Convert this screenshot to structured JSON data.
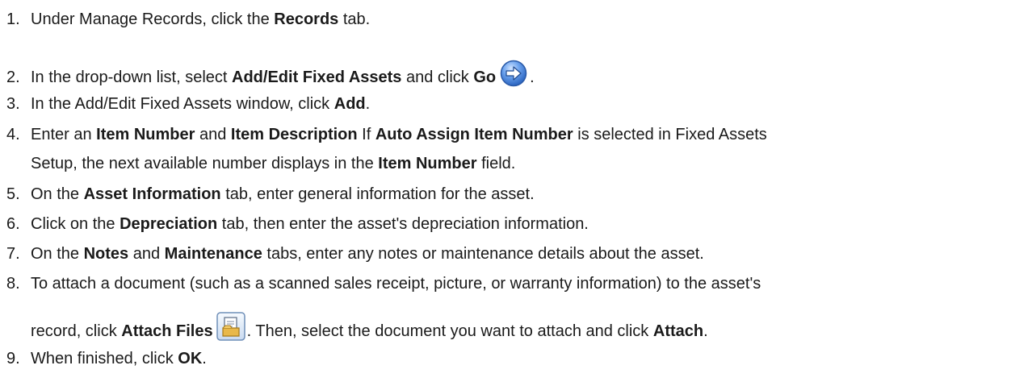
{
  "steps": [
    {
      "num": "1.",
      "pre": "Under Manage Records, click the ",
      "b1": "Records",
      "post": " tab."
    },
    {
      "num": "2.",
      "pre": "In the drop-down list, select ",
      "b1": "Add/Edit Fixed Assets",
      "mid": " and click ",
      "b2": "Go",
      "icon": "go-arrow-icon",
      "post": "."
    },
    {
      "num": "3.",
      "pre": "In the Add/Edit Fixed Assets window, click ",
      "b1": "Add",
      "post": "."
    },
    {
      "num": "4.",
      "line1": {
        "pre": "Enter an ",
        "b1": "Item Number",
        "mid1": " and ",
        "b2": "Item Description",
        "mid2": " If ",
        "b3": "Auto Assign Item Number",
        "post": " is selected in Fixed Assets"
      },
      "line2": {
        "pre": "Setup, the next available number displays in the ",
        "b1": "Item Number",
        "post": " field."
      }
    },
    {
      "num": "5.",
      "pre": "On the ",
      "b1": "Asset Information",
      "post": " tab, enter general information for the asset."
    },
    {
      "num": "6.",
      "pre": "Click on the ",
      "b1": "Depreciation",
      "post": " tab, then enter the asset's depreciation information."
    },
    {
      "num": "7.",
      "pre": "On the ",
      "b1": "Notes",
      "mid": " and ",
      "b2": "Maintenance",
      "post": " tabs, enter any notes or maintenance details about the asset."
    },
    {
      "num": "8.",
      "line1": {
        "text": "To attach a document (such as a scanned sales receipt, picture, or warranty information) to the asset's"
      },
      "line2": {
        "pre": "record, click ",
        "b1": "Attach Files",
        "icon": "attach-files-icon",
        "mid": ". Then, select the document you want to attach and click ",
        "b2": "Attach",
        "post": "."
      }
    },
    {
      "num": "9.",
      "pre": "When finished, click ",
      "b1": "OK",
      "post": "."
    }
  ],
  "colors": {
    "text": "#1a1a1a",
    "go_icon_fill": "#3f7fd6",
    "attach_icon_fill": "#e8b84a"
  }
}
